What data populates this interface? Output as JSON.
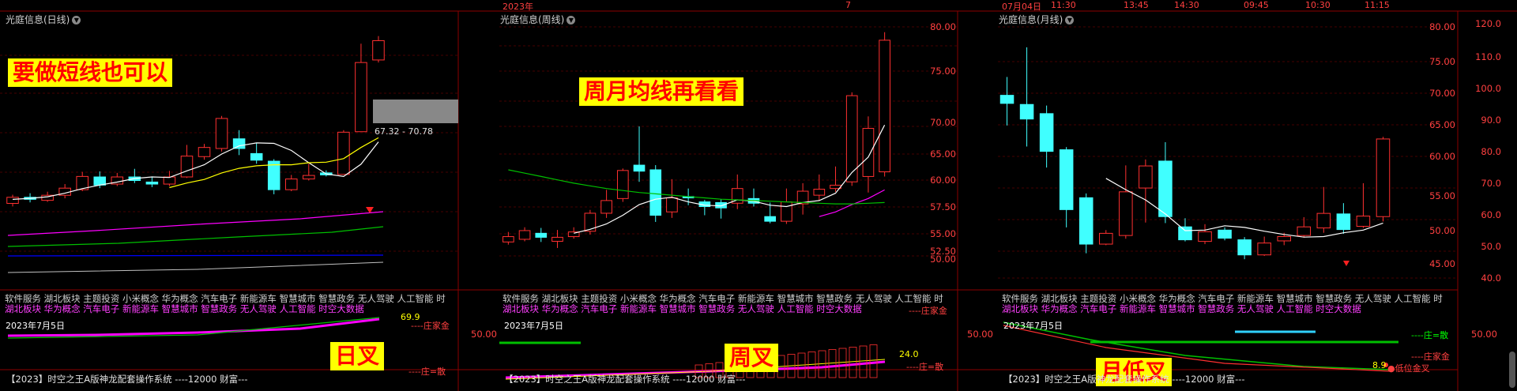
{
  "colors": {
    "grid": "#8b0000",
    "up": "#ff3030",
    "down": "#40ffff",
    "ma5": "#ffffff",
    "ma10": "#ffff00",
    "ma20": "#ff00ff",
    "ma60": "#00c000",
    "ma120": "#0000ff",
    "banner_bg": "#ffff00",
    "banner_fg": "#ff0000"
  },
  "topbar": {
    "left": "",
    "mid_year": "2023年",
    "mid_month": "7",
    "right_items": [
      "07月04日",
      "11:30",
      "13:45",
      "14:30",
      "09:45",
      "10:30",
      "11:15"
    ]
  },
  "panel_day": {
    "title": "光庭信息(日线)",
    "banner": "要做短线也可以",
    "box_label": "67.32 - 70.78",
    "sub_banner": "日叉",
    "value_label": "69.9",
    "zhuangjia": "----庄家金",
    "zhuangsan": "----庄=散",
    "date": "2023年7月5日"
  },
  "panel_week": {
    "title": "光庭信息(周线)",
    "banner": "周月均线再看看",
    "sub_banner": "周叉",
    "value_label": "24.0",
    "zhuangsan": "----庄=散",
    "zhuangjia": "----庄家金",
    "date": "2023年7月5日",
    "sub_axis": "50.00",
    "axis": [
      "80.00",
      "75.00",
      "70.00",
      "65.00",
      "60.00",
      "57.50",
      "55.00",
      "52.50",
      "50.00"
    ]
  },
  "panel_month": {
    "title": "光庭信息(月线)",
    "sub_banner": "月低叉",
    "zhuangsan": "----庄=散",
    "zhuangjia": "----庄家金",
    "low_label": "●低位金叉",
    "date": "2023年7月5日",
    "value_label": "8.9",
    "sub_axis": "50.00",
    "axis": [
      "80.00",
      "75.00",
      "70.00",
      "65.00",
      "60.00",
      "55.00",
      "50.00",
      "45.00"
    ]
  },
  "right_axis": {
    "labels": [
      "120.0",
      "110.0",
      "100.0",
      "90.0",
      "80.0",
      "70.0",
      "60.0",
      "50.0",
      "40.0"
    ],
    "sub": "50.00"
  },
  "concepts_line1": "软件服务 湖北板块 主题投资 小米概念 华为概念 汽车电子 新能源车 智慧城市 智慧政务 无人驾驶 人工智能 时",
  "concepts_line2": "湖北板块 华为概念 汽车电子 新能源车 智慧城市 智慧政务 无人驾驶 人工智能 时空大数据",
  "sysbar": "【2023】时空之王A版神龙配套操作系统 ----12000 财富---",
  "chart_data": [
    {
      "type": "candlestick",
      "name": "日线",
      "candles": [
        [
          48.6,
          49.8,
          48.0,
          50.3
        ],
        [
          49.8,
          49.4,
          48.8,
          50.6
        ],
        [
          49.2,
          50.2,
          48.9,
          50.9
        ],
        [
          50.2,
          51.6,
          49.6,
          52.4
        ],
        [
          51.3,
          53.9,
          51.0,
          54.8
        ],
        [
          53.8,
          52.2,
          51.6,
          54.9
        ],
        [
          52.4,
          53.8,
          52.0,
          54.6
        ],
        [
          53.8,
          53.1,
          52.6,
          55.4
        ],
        [
          52.8,
          52.4,
          51.8,
          53.9
        ],
        [
          52.4,
          53.8,
          52.0,
          55.0
        ],
        [
          53.8,
          57.9,
          53.6,
          60.1
        ],
        [
          57.8,
          59.6,
          57.2,
          60.3
        ],
        [
          59.4,
          65.3,
          58.8,
          65.8
        ],
        [
          61.3,
          59.4,
          58.1,
          63.0
        ],
        [
          58.4,
          57.1,
          56.4,
          60.5
        ],
        [
          56.9,
          51.3,
          50.4,
          57.3
        ],
        [
          51.3,
          53.4,
          51.0,
          54.2
        ],
        [
          53.4,
          54.1,
          53.1,
          56.4
        ],
        [
          54.6,
          54.2,
          53.9,
          55.1
        ],
        [
          54.3,
          62.6,
          54.3,
          63.0
        ],
        [
          62.7,
          76.3,
          62.7,
          80.0
        ],
        [
          76.8,
          80.6,
          76.3,
          81.5
        ]
      ],
      "ma5": [
        49.4,
        49.6,
        49.9,
        50.6,
        51.5,
        52.2,
        52.8,
        53.5,
        53.8,
        53.7,
        55.0,
        56.2,
        58.3,
        59.9,
        60.5,
        60.4,
        59.0,
        56.6,
        54.4,
        53.9,
        56.3,
        60.7
      ],
      "ma10": [
        null,
        null,
        null,
        null,
        null,
        null,
        null,
        null,
        null,
        51.7,
        52.6,
        53.3,
        54.6,
        55.5,
        56.0,
        56.2,
        56.2,
        56.6,
        56.7,
        57.4,
        59.6,
        61.5
      ]
    },
    {
      "type": "candlestick",
      "name": "周线",
      "candles": [
        [
          48.8,
          49.6,
          48.4,
          50.3
        ],
        [
          49.2,
          50.5,
          48.9,
          51.0
        ],
        [
          50.1,
          49.5,
          48.8,
          50.9
        ],
        [
          48.9,
          49.5,
          47.9,
          50.6
        ],
        [
          49.6,
          50.3,
          49.3,
          51.0
        ],
        [
          50.4,
          53.1,
          49.9,
          53.6
        ],
        [
          53.1,
          55.0,
          52.4,
          56.6
        ],
        [
          55.3,
          59.5,
          54.8,
          59.8
        ],
        [
          60.3,
          59.4,
          57.8,
          66.1
        ],
        [
          59.6,
          52.8,
          51.8,
          60.3
        ],
        [
          53.3,
          55.4,
          52.4,
          58.2
        ],
        [
          55.6,
          55.4,
          54.3,
          56.8
        ],
        [
          54.8,
          54.1,
          52.8,
          55.1
        ],
        [
          54.7,
          53.9,
          52.3,
          55.2
        ],
        [
          54.6,
          56.8,
          53.7,
          58.9
        ],
        [
          55.3,
          54.6,
          54.1,
          56.8
        ],
        [
          52.6,
          51.9,
          51.6,
          54.7
        ],
        [
          51.9,
          54.8,
          51.5,
          56.8
        ],
        [
          54.5,
          56.4,
          52.9,
          57.6
        ],
        [
          55.8,
          56.7,
          55.0,
          58.9
        ],
        [
          56.8,
          57.3,
          56.3,
          60.1
        ],
        [
          57.8,
          70.7,
          57.2,
          71.2
        ],
        [
          58.6,
          65.8,
          56.2,
          67.6
        ],
        [
          59.3,
          79.0,
          58.6,
          80.2
        ]
      ],
      "ma5": [
        null,
        null,
        null,
        null,
        50.1,
        50.7,
        51.5,
        52.8,
        54.4,
        55.2,
        55.5,
        54.8,
        54.3,
        54.2,
        55.1,
        54.9,
        54.3,
        54.1,
        54.7,
        55.0,
        56.1,
        59.2,
        61.5,
        66.3
      ],
      "ma20": [
        null,
        null,
        null,
        null,
        null,
        null,
        null,
        null,
        null,
        null,
        null,
        null,
        null,
        null,
        null,
        null,
        null,
        null,
        null,
        52.6,
        53.3,
        54.4,
        55.3,
        56.6
      ],
      "ma60": [
        59.6,
        59.1,
        58.6,
        58.1,
        57.6,
        57.2,
        56.8,
        56.5,
        56.2,
        56.0,
        55.8,
        55.6,
        55.4,
        55.2,
        55.1,
        55.0,
        54.9,
        54.8,
        54.7,
        54.6,
        54.5,
        54.5,
        54.6,
        54.7
      ]
    },
    {
      "type": "candlestick",
      "name": "月线",
      "candles": [
        [
          70.6,
          69.1,
          65.0,
          74.0
        ],
        [
          68.9,
          66.2,
          61.1,
          79.5
        ],
        [
          67.2,
          60.2,
          57.2,
          68.7
        ],
        [
          60.5,
          49.4,
          46.1,
          61.0
        ],
        [
          51.6,
          43.0,
          41.3,
          52.4
        ],
        [
          43.0,
          45.0,
          42.8,
          45.6
        ],
        [
          44.6,
          52.7,
          44.0,
          57.6
        ],
        [
          53.4,
          57.5,
          47.0,
          58.7
        ],
        [
          58.4,
          48.1,
          46.9,
          61.9
        ],
        [
          46.2,
          43.8,
          43.5,
          47.8
        ],
        [
          43.5,
          45.3,
          43.0,
          46.7
        ],
        [
          45.6,
          44.1,
          43.7,
          46.1
        ],
        [
          43.8,
          41.0,
          40.2,
          44.3
        ],
        [
          41.0,
          43.2,
          40.8,
          44.4
        ],
        [
          43.6,
          44.4,
          42.8,
          45.1
        ],
        [
          44.6,
          46.2,
          44.2,
          48.0
        ],
        [
          46.0,
          48.7,
          45.1,
          53.6
        ],
        [
          48.6,
          45.7,
          44.9,
          50.6
        ],
        [
          46.3,
          48.2,
          46.0,
          54.3
        ],
        [
          48.1,
          62.5,
          47.2,
          62.9
        ]
      ],
      "ma5": [
        null,
        null,
        null,
        null,
        null,
        55.2,
        53.1,
        51.2,
        48.6,
        45.5,
        45.6,
        46.4,
        46.1,
        45.4,
        44.8,
        44.3,
        44.4,
        45.1,
        45.6,
        46.9
      ]
    }
  ]
}
